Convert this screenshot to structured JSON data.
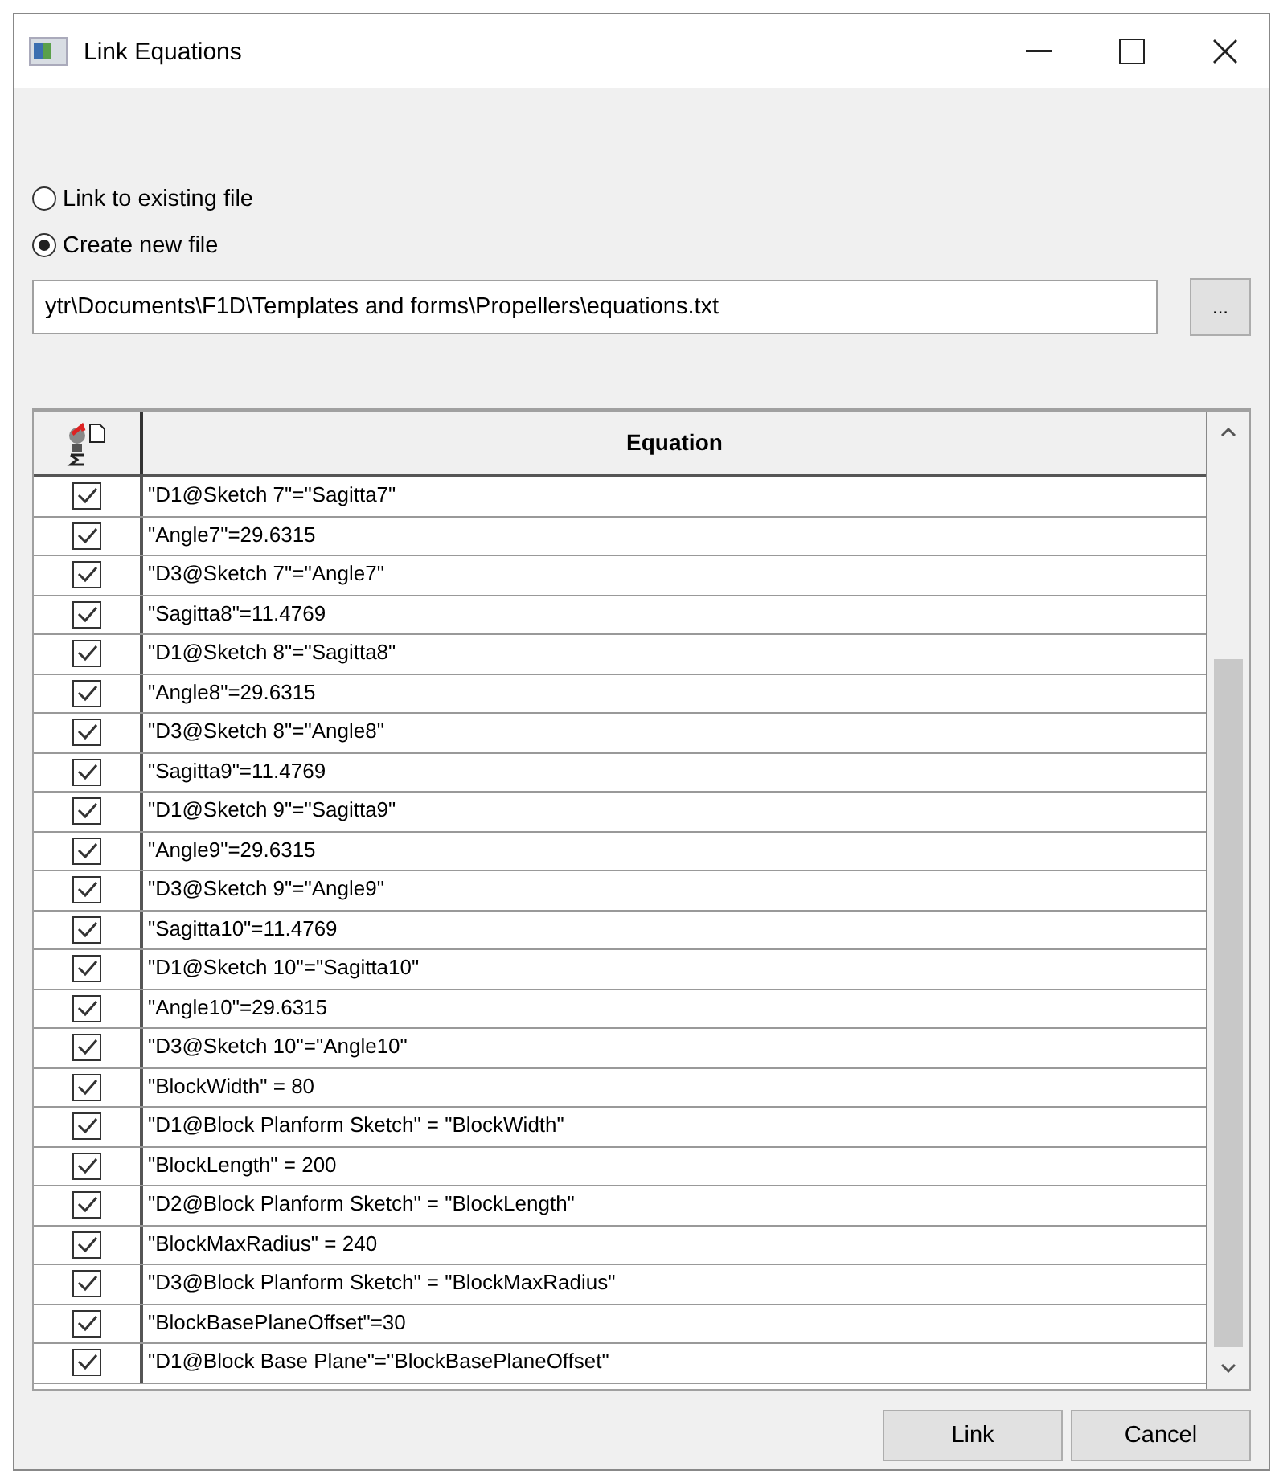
{
  "window": {
    "title": "Link Equations"
  },
  "options": [
    {
      "label": "Link to existing file",
      "selected": false
    },
    {
      "label": "Create new file",
      "selected": true
    }
  ],
  "file_path": {
    "value": "ytr\\Documents\\F1D\\Templates and forms\\Propellers\\equations.txt"
  },
  "browse_button": "...",
  "table": {
    "columns": [
      "Equation"
    ],
    "rows": [
      {
        "checked": true,
        "equation": "\"D1@Sketch 7\"=\"Sagitta7\""
      },
      {
        "checked": true,
        "equation": "\"Angle7\"=29.6315"
      },
      {
        "checked": true,
        "equation": "\"D3@Sketch 7\"=\"Angle7\""
      },
      {
        "checked": true,
        "equation": "\"Sagitta8\"=11.4769"
      },
      {
        "checked": true,
        "equation": "\"D1@Sketch 8\"=\"Sagitta8\""
      },
      {
        "checked": true,
        "equation": "\"Angle8\"=29.6315"
      },
      {
        "checked": true,
        "equation": "\"D3@Sketch 8\"=\"Angle8\""
      },
      {
        "checked": true,
        "equation": "\"Sagitta9\"=11.4769"
      },
      {
        "checked": true,
        "equation": "\"D1@Sketch 9\"=\"Sagitta9\""
      },
      {
        "checked": true,
        "equation": "\"Angle9\"=29.6315"
      },
      {
        "checked": true,
        "equation": "\"D3@Sketch 9\"=\"Angle9\""
      },
      {
        "checked": true,
        "equation": "\"Sagitta10\"=11.4769"
      },
      {
        "checked": true,
        "equation": "\"D1@Sketch 10\"=\"Sagitta10\""
      },
      {
        "checked": true,
        "equation": "\"Angle10\"=29.6315"
      },
      {
        "checked": true,
        "equation": "\"D3@Sketch 10\"=\"Angle10\""
      },
      {
        "checked": true,
        "equation": "\"BlockWidth\" = 80"
      },
      {
        "checked": true,
        "equation": "\"D1@Block Planform Sketch\" = \"BlockWidth\""
      },
      {
        "checked": true,
        "equation": "\"BlockLength\" = 200"
      },
      {
        "checked": true,
        "equation": "\"D2@Block Planform Sketch\" = \"BlockLength\""
      },
      {
        "checked": true,
        "equation": "\"BlockMaxRadius\" = 240"
      },
      {
        "checked": true,
        "equation": "\"D3@Block Planform Sketch\" = \"BlockMaxRadius\""
      },
      {
        "checked": true,
        "equation": "\"BlockBasePlaneOffset\"=30"
      },
      {
        "checked": true,
        "equation": "\"D1@Block Base Plane\"=\"BlockBasePlaneOffset\""
      }
    ]
  },
  "buttons": [
    "Link",
    "Cancel"
  ]
}
